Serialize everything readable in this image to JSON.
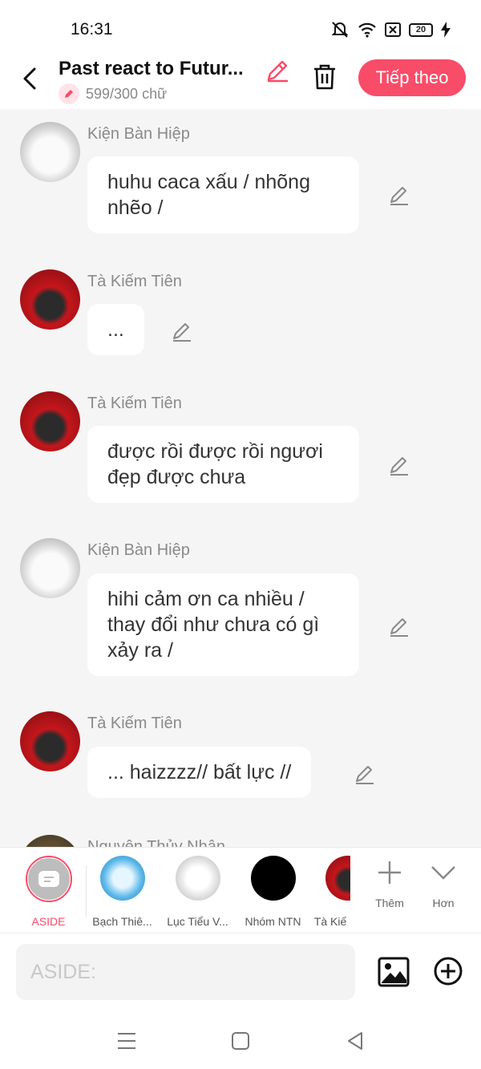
{
  "status": {
    "time": "16:31",
    "battery": "20"
  },
  "header": {
    "title": "Past react to Futur...",
    "counter": "599/300 chữ",
    "next_label": "Tiếp theo"
  },
  "messages": [
    {
      "name": "Kiện Bàn Hiệp",
      "lines": [
        "huhu caca xấu / nhõng",
        "nhẽo /"
      ],
      "avatar": "white"
    },
    {
      "name": "Tà Kiếm Tiên",
      "lines": [
        "..."
      ],
      "avatar": "red"
    },
    {
      "name": "Tà Kiếm Tiên",
      "lines": [
        "được rồi được rồi ngươi",
        "đẹp được chưa"
      ],
      "avatar": "red"
    },
    {
      "name": "Kiện Bàn Hiệp",
      "lines": [
        "hihi cảm ơn ca nhiều /",
        "thay đổi như chưa có gì",
        "xảy ra /"
      ],
      "avatar": "white"
    },
    {
      "name": "Tà Kiếm Tiên",
      "lines": [
        "... haizzzz// bất lực //"
      ],
      "avatar": "red"
    },
    {
      "name": "Nguyên Thủy Nhân",
      "lines": [],
      "avatar": "dark"
    }
  ],
  "characters": [
    {
      "label": "ASIDE",
      "active": true
    },
    {
      "label": "Bạch Thiê...",
      "color": "#5bb8e8"
    },
    {
      "label": "Lục Tiểu V...",
      "color": "#f0f0f0"
    },
    {
      "label": "Nhóm NTN",
      "color": "#000000"
    },
    {
      "label": "Tà Kiế",
      "color": "#c4161c"
    }
  ],
  "tools": {
    "more_label": "Thêm",
    "expand_label": "Hơn"
  },
  "composer": {
    "placeholder": "ASIDE:"
  },
  "colors": {
    "accent": "#f94c68"
  }
}
